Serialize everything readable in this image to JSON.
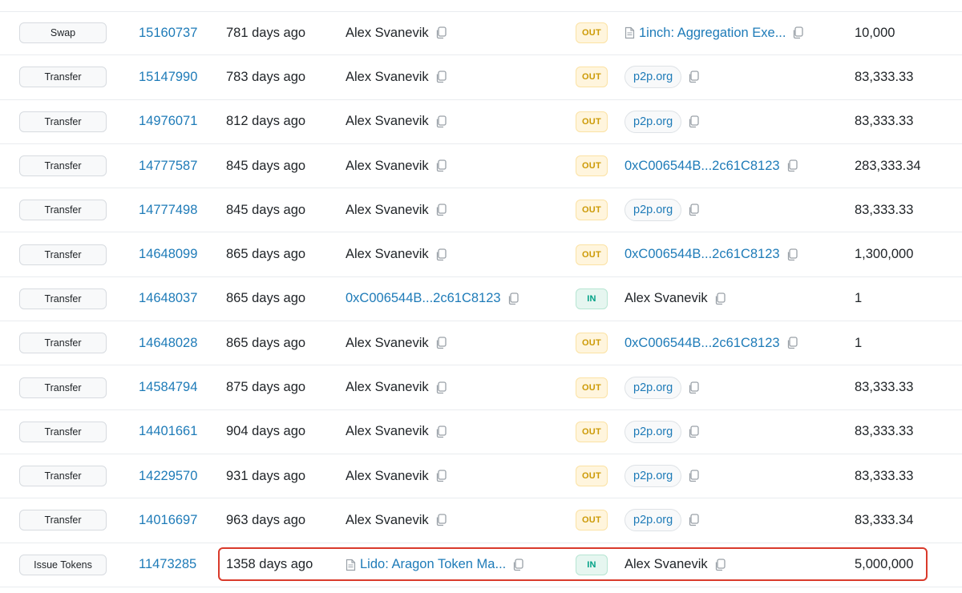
{
  "highlight_color": "#d93a2b",
  "rows": [
    {
      "method": "Swap",
      "block": "15160737",
      "age": "781 days ago",
      "from": "Alex Svanevik",
      "from_link": false,
      "from_doc": false,
      "direction": "OUT",
      "to": "1inch: Aggregation Exe...",
      "to_style": "doc-link",
      "quantity": "10,000"
    },
    {
      "method": "Transfer",
      "block": "15147990",
      "age": "783 days ago",
      "from": "Alex Svanevik",
      "from_link": false,
      "from_doc": false,
      "direction": "OUT",
      "to": "p2p.org",
      "to_style": "pill",
      "quantity": "83,333.33"
    },
    {
      "method": "Transfer",
      "block": "14976071",
      "age": "812 days ago",
      "from": "Alex Svanevik",
      "from_link": false,
      "from_doc": false,
      "direction": "OUT",
      "to": "p2p.org",
      "to_style": "pill",
      "quantity": "83,333.33"
    },
    {
      "method": "Transfer",
      "block": "14777587",
      "age": "845 days ago",
      "from": "Alex Svanevik",
      "from_link": false,
      "from_doc": false,
      "direction": "OUT",
      "to": "0xC006544B...2c61C8123",
      "to_style": "link",
      "quantity": "283,333.34"
    },
    {
      "method": "Transfer",
      "block": "14777498",
      "age": "845 days ago",
      "from": "Alex Svanevik",
      "from_link": false,
      "from_doc": false,
      "direction": "OUT",
      "to": "p2p.org",
      "to_style": "pill",
      "quantity": "83,333.33"
    },
    {
      "method": "Transfer",
      "block": "14648099",
      "age": "865 days ago",
      "from": "Alex Svanevik",
      "from_link": false,
      "from_doc": false,
      "direction": "OUT",
      "to": "0xC006544B...2c61C8123",
      "to_style": "link",
      "quantity": "1,300,000"
    },
    {
      "method": "Transfer",
      "block": "14648037",
      "age": "865 days ago",
      "from": "0xC006544B...2c61C8123",
      "from_link": true,
      "from_doc": false,
      "direction": "IN",
      "to": "Alex Svanevik",
      "to_style": "text",
      "quantity": "1"
    },
    {
      "method": "Transfer",
      "block": "14648028",
      "age": "865 days ago",
      "from": "Alex Svanevik",
      "from_link": false,
      "from_doc": false,
      "direction": "OUT",
      "to": "0xC006544B...2c61C8123",
      "to_style": "link",
      "quantity": "1"
    },
    {
      "method": "Transfer",
      "block": "14584794",
      "age": "875 days ago",
      "from": "Alex Svanevik",
      "from_link": false,
      "from_doc": false,
      "direction": "OUT",
      "to": "p2p.org",
      "to_style": "pill",
      "quantity": "83,333.33"
    },
    {
      "method": "Transfer",
      "block": "14401661",
      "age": "904 days ago",
      "from": "Alex Svanevik",
      "from_link": false,
      "from_doc": false,
      "direction": "OUT",
      "to": "p2p.org",
      "to_style": "pill",
      "quantity": "83,333.33"
    },
    {
      "method": "Transfer",
      "block": "14229570",
      "age": "931 days ago",
      "from": "Alex Svanevik",
      "from_link": false,
      "from_doc": false,
      "direction": "OUT",
      "to": "p2p.org",
      "to_style": "pill",
      "quantity": "83,333.33"
    },
    {
      "method": "Transfer",
      "block": "14016697",
      "age": "963 days ago",
      "from": "Alex Svanevik",
      "from_link": false,
      "from_doc": false,
      "direction": "OUT",
      "to": "p2p.org",
      "to_style": "pill",
      "quantity": "83,333.34"
    },
    {
      "method": "Issue Tokens",
      "block": "11473285",
      "age": "1358 days ago",
      "from": "Lido: Aragon Token Ma...",
      "from_link": true,
      "from_doc": true,
      "direction": "IN",
      "to": "Alex Svanevik",
      "to_style": "text",
      "quantity": "5,000,000",
      "highlighted": true
    }
  ]
}
